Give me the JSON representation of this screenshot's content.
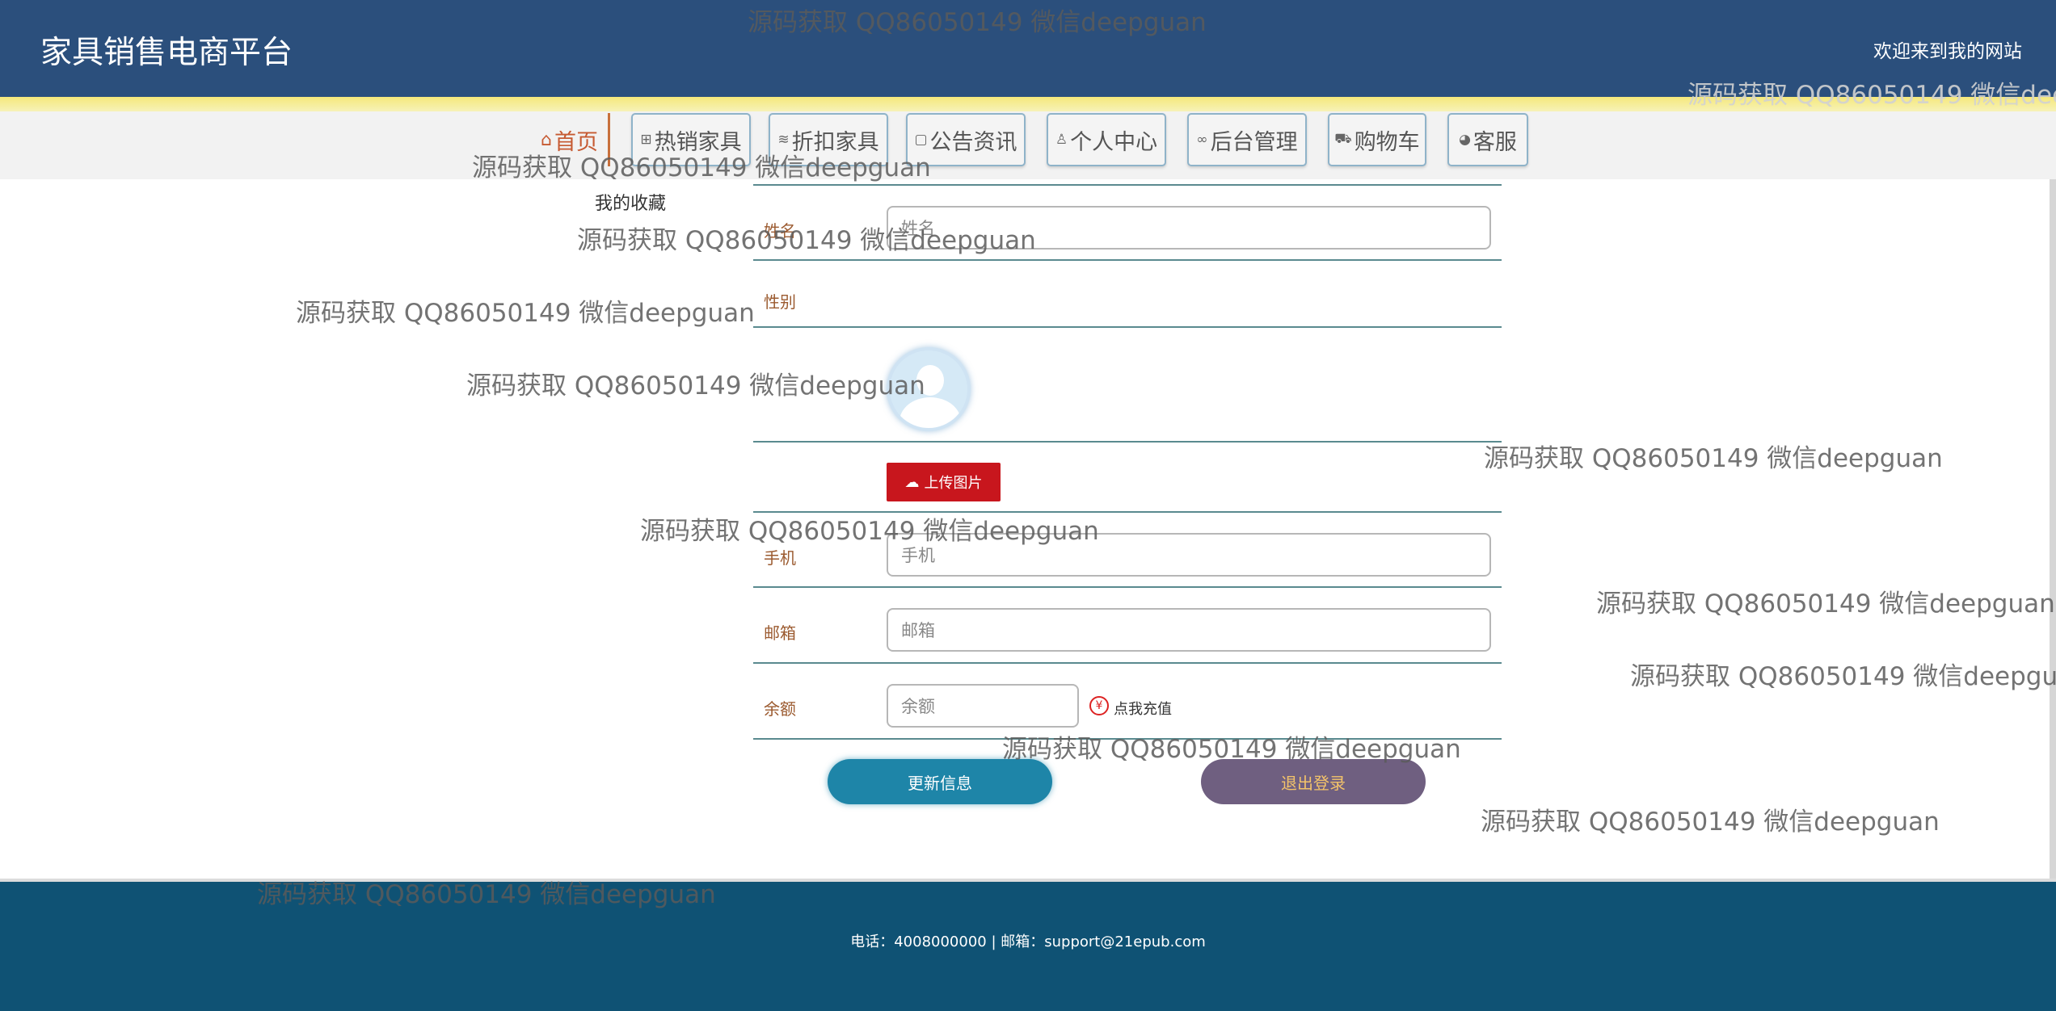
{
  "header": {
    "title": "家具销售电商平台",
    "welcome": "欢迎来到我的网站"
  },
  "nav": {
    "items": [
      {
        "label": "首页",
        "icon": "home-icon"
      },
      {
        "label": "热销家具",
        "icon": "grid-icon"
      },
      {
        "label": "折扣家具",
        "icon": "layers-icon"
      },
      {
        "label": "公告资讯",
        "icon": "note-icon"
      },
      {
        "label": "个人中心",
        "icon": "user-icon"
      },
      {
        "label": "后台管理",
        "icon": "link-icon"
      },
      {
        "label": "购物车",
        "icon": "cart-icon"
      },
      {
        "label": "客服",
        "icon": "chat-icon"
      }
    ]
  },
  "sidebar": {
    "favorites": "我的收藏"
  },
  "form": {
    "name_label": "姓名",
    "name_placeholder": "姓名",
    "gender_label": "性别",
    "upload_label": "上传图片",
    "phone_label": "手机",
    "phone_placeholder": "手机",
    "email_label": "邮箱",
    "email_placeholder": "邮箱",
    "balance_label": "余额",
    "balance_placeholder": "余额",
    "recharge_icon": "¥",
    "recharge_label": "点我充值",
    "update_button": "更新信息",
    "logout_button": "退出登录"
  },
  "footer": {
    "contact": "电话：4008000000 | 邮箱：support@21epub.com"
  },
  "watermark": {
    "text": "源码获取 QQ86050149 微信deepguan"
  }
}
